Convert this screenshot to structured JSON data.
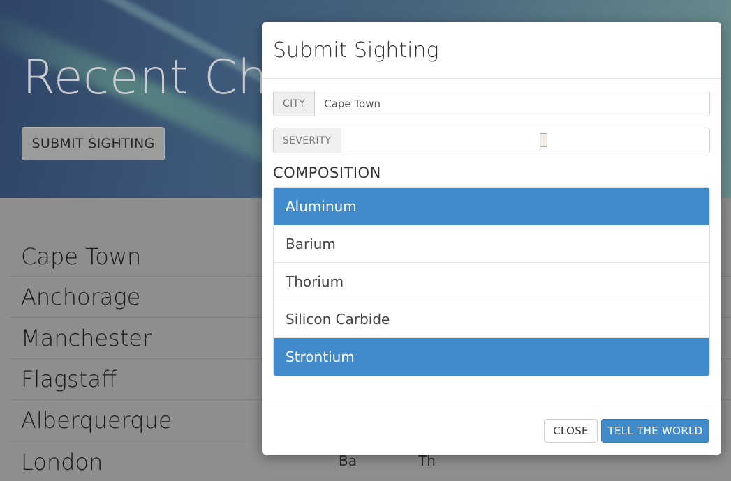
{
  "hero": {
    "title": "Recent Che",
    "submit_button": "SUBMIT SIGHTING"
  },
  "list": {
    "cities": [
      "Cape Town",
      "Anchorage",
      "Manchester",
      "Flagstaff",
      "Alberquerque",
      "London"
    ],
    "peek_values": [
      "Ba",
      "Th"
    ]
  },
  "modal": {
    "title": "Submit Sighting",
    "city_label": "CITY",
    "city_value": "Cape Town",
    "severity_label": "SEVERITY",
    "severity_value": 0.55,
    "composition_label": "COMPOSITION",
    "options": [
      {
        "label": "Aluminum",
        "selected": true
      },
      {
        "label": "Barium",
        "selected": false
      },
      {
        "label": "Thorium",
        "selected": false
      },
      {
        "label": "Silicon Carbide",
        "selected": false
      },
      {
        "label": "Strontium",
        "selected": true
      }
    ],
    "close_button": "CLOSE",
    "primary_button": "TELL THE WORLD"
  },
  "colors": {
    "accent": "#428bca",
    "overlay": "#8e8e8e"
  }
}
